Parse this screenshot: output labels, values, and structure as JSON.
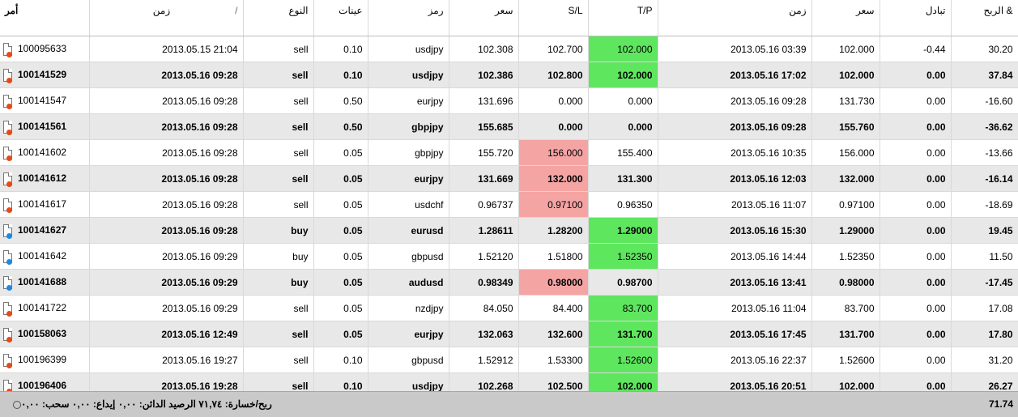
{
  "headers": {
    "order": "أمر",
    "open_time": "زمن",
    "open_time_sort": "/",
    "type": "النوع",
    "size": "عينات",
    "symbol": "رمز",
    "open_price": "سعر",
    "sl": "S/L",
    "tp": "T/P",
    "close_time": "زمن",
    "close_price": "سعر",
    "swap": "تبادل",
    "profit": "الربح &"
  },
  "colors": {
    "tp_hit": "#5ee65e",
    "sl_hit": "#f5a4a4",
    "row_alt": "#e8e8e8",
    "footer_bg": "#c9c9c9",
    "sell_dot": "#e64a19",
    "buy_dot": "#1e88e5"
  },
  "rows": [
    {
      "order": "100095633",
      "open_time": "2013.05.15 21:04",
      "type": "sell",
      "size": "0.10",
      "symbol": "usdjpy",
      "open_price": "102.308",
      "sl": "102.700",
      "tp": "102.000",
      "close_time": "2013.05.16 03:39",
      "close_price": "102.000",
      "swap": "-0.44",
      "profit": "30.20",
      "hit": "tp",
      "icon": "sell-doc-icon"
    },
    {
      "order": "100141529",
      "open_time": "2013.05.16 09:28",
      "type": "sell",
      "size": "0.10",
      "symbol": "usdjpy",
      "open_price": "102.386",
      "sl": "102.800",
      "tp": "102.000",
      "close_time": "2013.05.16 17:02",
      "close_price": "102.000",
      "swap": "0.00",
      "profit": "37.84",
      "hit": "tp",
      "icon": "sell-doc-icon"
    },
    {
      "order": "100141547",
      "open_time": "2013.05.16 09:28",
      "type": "sell",
      "size": "0.50",
      "symbol": "eurjpy",
      "open_price": "131.696",
      "sl": "0.000",
      "tp": "0.000",
      "close_time": "2013.05.16 09:28",
      "close_price": "131.730",
      "swap": "0.00",
      "profit": "-16.60",
      "hit": "",
      "icon": "sell-doc-icon"
    },
    {
      "order": "100141561",
      "open_time": "2013.05.16 09:28",
      "type": "sell",
      "size": "0.50",
      "symbol": "gbpjpy",
      "open_price": "155.685",
      "sl": "0.000",
      "tp": "0.000",
      "close_time": "2013.05.16 09:28",
      "close_price": "155.760",
      "swap": "0.00",
      "profit": "-36.62",
      "hit": "",
      "icon": "sell-doc-icon"
    },
    {
      "order": "100141602",
      "open_time": "2013.05.16 09:28",
      "type": "sell",
      "size": "0.05",
      "symbol": "gbpjpy",
      "open_price": "155.720",
      "sl": "156.000",
      "tp": "155.400",
      "close_time": "2013.05.16 10:35",
      "close_price": "156.000",
      "swap": "0.00",
      "profit": "-13.66",
      "hit": "sl",
      "icon": "sell-doc-icon"
    },
    {
      "order": "100141612",
      "open_time": "2013.05.16 09:28",
      "type": "sell",
      "size": "0.05",
      "symbol": "eurjpy",
      "open_price": "131.669",
      "sl": "132.000",
      "tp": "131.300",
      "close_time": "2013.05.16 12:03",
      "close_price": "132.000",
      "swap": "0.00",
      "profit": "-16.14",
      "hit": "sl",
      "icon": "sell-doc-icon"
    },
    {
      "order": "100141617",
      "open_time": "2013.05.16 09:28",
      "type": "sell",
      "size": "0.05",
      "symbol": "usdchf",
      "open_price": "0.96737",
      "sl": "0.97100",
      "tp": "0.96350",
      "close_time": "2013.05.16 11:07",
      "close_price": "0.97100",
      "swap": "0.00",
      "profit": "-18.69",
      "hit": "sl",
      "icon": "sell-doc-icon"
    },
    {
      "order": "100141627",
      "open_time": "2013.05.16 09:28",
      "type": "buy",
      "size": "0.05",
      "symbol": "eurusd",
      "open_price": "1.28611",
      "sl": "1.28200",
      "tp": "1.29000",
      "close_time": "2013.05.16 15:30",
      "close_price": "1.29000",
      "swap": "0.00",
      "profit": "19.45",
      "hit": "tp",
      "icon": "buy-doc-icon"
    },
    {
      "order": "100141642",
      "open_time": "2013.05.16 09:29",
      "type": "buy",
      "size": "0.05",
      "symbol": "gbpusd",
      "open_price": "1.52120",
      "sl": "1.51800",
      "tp": "1.52350",
      "close_time": "2013.05.16 14:44",
      "close_price": "1.52350",
      "swap": "0.00",
      "profit": "11.50",
      "hit": "tp",
      "icon": "buy-doc-icon"
    },
    {
      "order": "100141688",
      "open_time": "2013.05.16 09:29",
      "type": "buy",
      "size": "0.05",
      "symbol": "audusd",
      "open_price": "0.98349",
      "sl": "0.98000",
      "tp": "0.98700",
      "close_time": "2013.05.16 13:41",
      "close_price": "0.98000",
      "swap": "0.00",
      "profit": "-17.45",
      "hit": "sl",
      "icon": "buy-doc-icon"
    },
    {
      "order": "100141722",
      "open_time": "2013.05.16 09:29",
      "type": "sell",
      "size": "0.05",
      "symbol": "nzdjpy",
      "open_price": "84.050",
      "sl": "84.400",
      "tp": "83.700",
      "close_time": "2013.05.16 11:04",
      "close_price": "83.700",
      "swap": "0.00",
      "profit": "17.08",
      "hit": "tp",
      "icon": "sell-doc-icon"
    },
    {
      "order": "100158063",
      "open_time": "2013.05.16 12:49",
      "type": "sell",
      "size": "0.05",
      "symbol": "eurjpy",
      "open_price": "132.063",
      "sl": "132.600",
      "tp": "131.700",
      "close_time": "2013.05.16 17:45",
      "close_price": "131.700",
      "swap": "0.00",
      "profit": "17.80",
      "hit": "tp",
      "icon": "sell-doc-icon"
    },
    {
      "order": "100196399",
      "open_time": "2013.05.16 19:27",
      "type": "sell",
      "size": "0.10",
      "symbol": "gbpusd",
      "open_price": "1.52912",
      "sl": "1.53300",
      "tp": "1.52600",
      "close_time": "2013.05.16 22:37",
      "close_price": "1.52600",
      "swap": "0.00",
      "profit": "31.20",
      "hit": "tp",
      "icon": "sell-doc-icon"
    },
    {
      "order": "100196406",
      "open_time": "2013.05.16 19:28",
      "type": "sell",
      "size": "0.10",
      "symbol": "usdjpy",
      "open_price": "102.268",
      "sl": "102.500",
      "tp": "102.000",
      "close_time": "2013.05.16 20:51",
      "close_price": "102.000",
      "swap": "0.00",
      "profit": "26.27",
      "hit": "tp",
      "icon": "sell-doc-icon"
    }
  ],
  "footer": {
    "summary": "ربح/خسارة: ٧١,٧٤  الرصيد الدائن: ٠,٠٠  إيداع: ٠,٠٠  سحب: ٠,٠٠",
    "total": "71.74"
  }
}
